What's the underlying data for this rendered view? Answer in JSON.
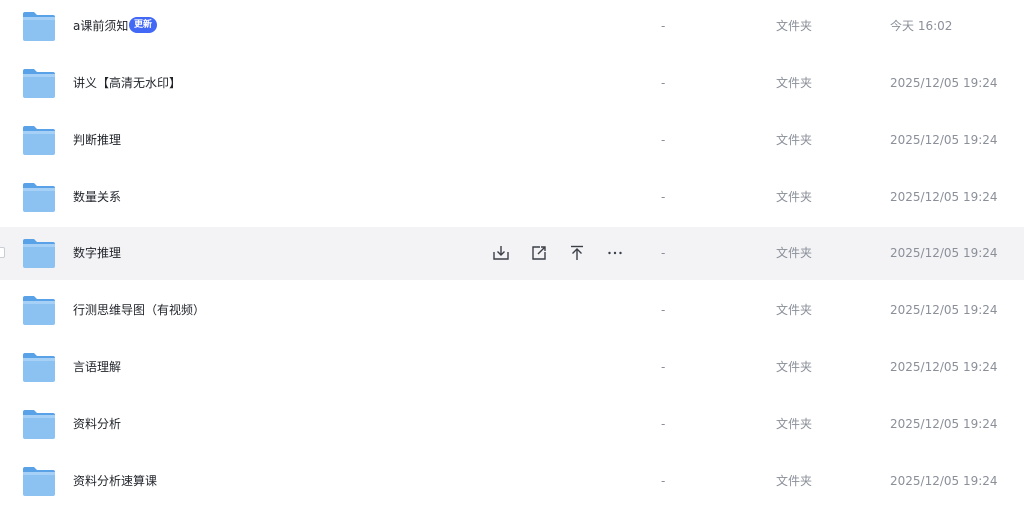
{
  "columns": {
    "size_placeholder": "-",
    "type_label": "文件夹"
  },
  "colors": {
    "badge_bg": "#4269f5",
    "hover_row_bg": "#f3f3f5",
    "folder_icon": "#7fb8f0"
  },
  "hover_actions": [
    {
      "icon": "download-icon"
    },
    {
      "icon": "share-icon"
    },
    {
      "icon": "move-to-top-icon"
    },
    {
      "icon": "more-icon"
    }
  ],
  "files": [
    {
      "name": "a课前须知",
      "badge": "更新",
      "size": "-",
      "type": "文件夹",
      "modified": "今天 16:02"
    },
    {
      "name": "讲义【高清无水印】",
      "size": "-",
      "type": "文件夹",
      "modified": "2025/12/05 19:24"
    },
    {
      "name": "判断推理",
      "size": "-",
      "type": "文件夹",
      "modified": "2025/12/05 19:24"
    },
    {
      "name": "数量关系",
      "size": "-",
      "type": "文件夹",
      "modified": "2025/12/05 19:24"
    },
    {
      "name": "数字推理",
      "size": "-",
      "type": "文件夹",
      "modified": "2025/12/05 19:24",
      "hovered": true
    },
    {
      "name": "行测思维导图（有视频）",
      "size": "-",
      "type": "文件夹",
      "modified": "2025/12/05 19:24"
    },
    {
      "name": "言语理解",
      "size": "-",
      "type": "文件夹",
      "modified": "2025/12/05 19:24"
    },
    {
      "name": "资料分析",
      "size": "-",
      "type": "文件夹",
      "modified": "2025/12/05 19:24"
    },
    {
      "name": "资料分析速算课",
      "size": "-",
      "type": "文件夹",
      "modified": "2025/12/05 19:24"
    }
  ]
}
